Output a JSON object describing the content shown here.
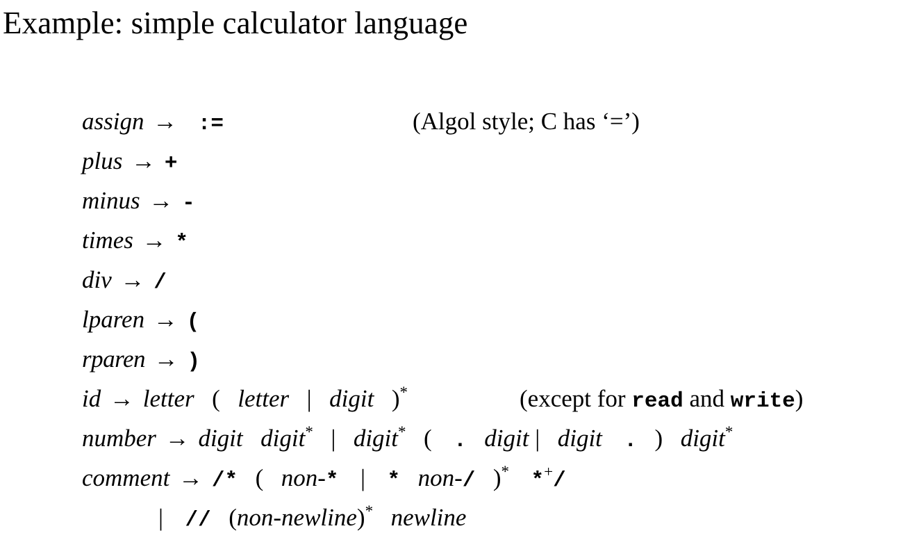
{
  "slide": {
    "title": "Example: simple calculator language",
    "arrow": "→",
    "alt_bar": "|",
    "lparen_meta": "(",
    "rparen_meta": ")",
    "star": "*",
    "plus": "+"
  },
  "grammar": {
    "rules": [
      {
        "name": "assign",
        "terminal": ":="
      },
      {
        "name": "plus",
        "terminal": "+"
      },
      {
        "name": "minus",
        "terminal": "-"
      },
      {
        "name": "times",
        "terminal": "*"
      },
      {
        "name": "div",
        "terminal": "/"
      },
      {
        "name": "lparen",
        "terminal": "("
      },
      {
        "name": "rparen",
        "terminal": ")"
      },
      {
        "name": "id",
        "terminal": ""
      },
      {
        "name": "number",
        "terminal": ""
      },
      {
        "name": "comment",
        "terminal": ""
      }
    ],
    "id_rule": {
      "name": "id",
      "letter": "letter",
      "letter2": "letter",
      "digit": "digit",
      "star": "*"
    },
    "number_rule": {
      "name": "number",
      "digit1": "digit",
      "digit2": "digit",
      "star1": "*",
      "digit3": "digit",
      "star2": "*",
      "dot1": ".",
      "digit4": "digit",
      "digit5": "digit",
      "dot2": ".",
      "digit6": "digit",
      "star3": "*"
    },
    "comment_rule": {
      "name": "comment",
      "open": "/*",
      "non_star": "non-",
      "star_term1": "*",
      "star_term2": "*",
      "non_slash": "non-",
      "slash_term1": "/",
      "group_star": "*",
      "star_term3": "*",
      "plus_sup": "+",
      "slash_term2": "/",
      "line2_slashes": "//",
      "non_newline": "non-newline",
      "line2_star": "*",
      "newline": "newline"
    }
  },
  "annotations": {
    "assign": {
      "open_paren": "(",
      "text_before": "Algol style; C has ",
      "quoted": "‘=’",
      "close_paren": ")"
    },
    "id": {
      "open_paren": "(",
      "text_before": "except for ",
      "keyword_read": "read",
      "text_middle": " and ",
      "keyword_write": "write",
      "close_paren": ")"
    }
  }
}
